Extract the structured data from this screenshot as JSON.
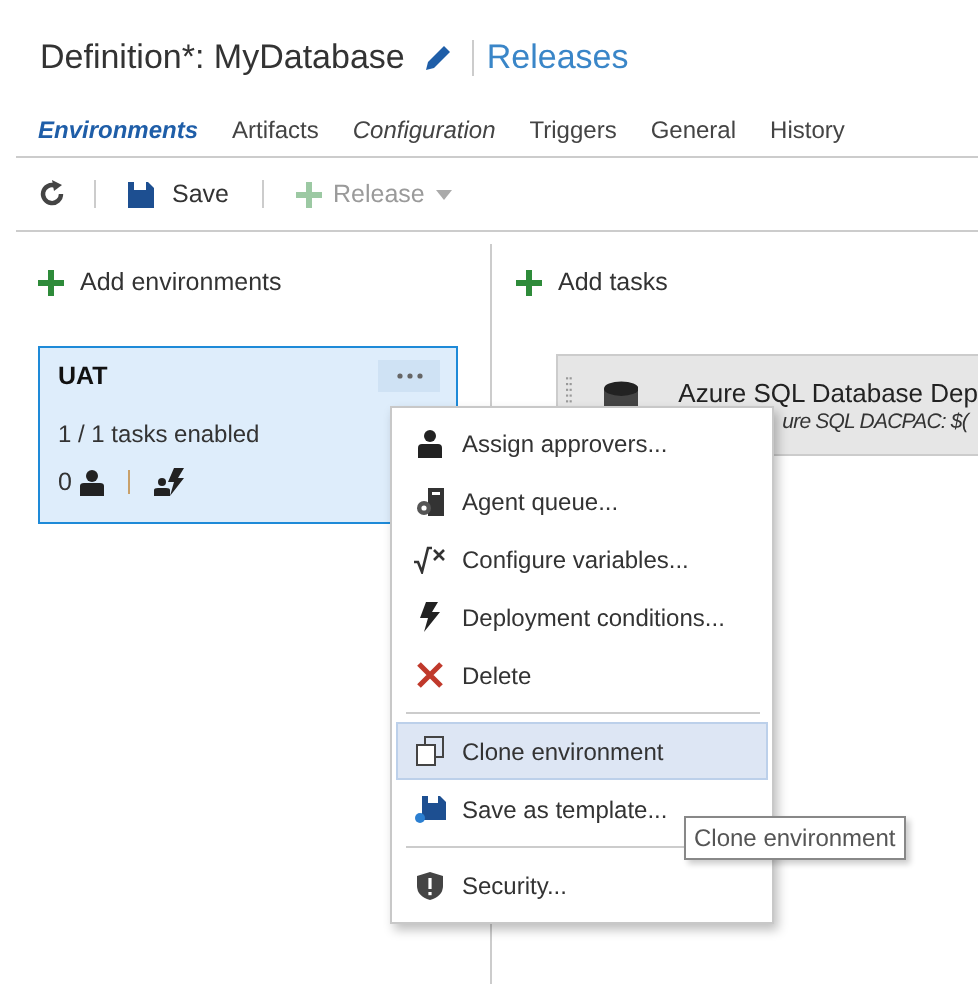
{
  "header": {
    "title": "Definition*: MyDatabase",
    "link": "Releases"
  },
  "tabs": [
    {
      "label": "Environments",
      "selected": true,
      "modified": true
    },
    {
      "label": "Artifacts",
      "selected": false,
      "modified": false
    },
    {
      "label": "Configuration",
      "selected": false,
      "modified": true
    },
    {
      "label": "Triggers",
      "selected": false,
      "modified": false
    },
    {
      "label": "General",
      "selected": false,
      "modified": false
    },
    {
      "label": "History",
      "selected": false,
      "modified": false
    }
  ],
  "toolbar": {
    "save": "Save",
    "release": {
      "label": "Release",
      "disabled": true
    }
  },
  "environments": {
    "add": "Add environments",
    "cards": [
      {
        "name": "UAT",
        "tasks": "1 / 1 tasks enabled",
        "approvers": "0",
        "selected": true
      }
    ]
  },
  "tasks": {
    "add": "Add tasks",
    "items": [
      {
        "title": "Azure SQL Database Dep",
        "subtitle": "ure SQL DACPAC: $("
      }
    ]
  },
  "menu": {
    "groups": [
      {
        "items": [
          {
            "label": "Assign approvers...",
            "kind": "person",
            "selected": false
          },
          {
            "label": "Agent queue...",
            "kind": "agent",
            "selected": false
          },
          {
            "label": "Configure variables...",
            "kind": "fx",
            "selected": false
          },
          {
            "label": "Deployment conditions...",
            "kind": "bolt",
            "selected": false
          },
          {
            "label": "Delete",
            "kind": "delete",
            "selected": false
          }
        ]
      },
      {
        "items": [
          {
            "label": "Clone environment",
            "kind": "clone",
            "selected": true
          },
          {
            "label": "Save as template...",
            "kind": "template",
            "selected": false
          }
        ]
      },
      {
        "items": [
          {
            "label": "Security...",
            "kind": "shield",
            "selected": false
          }
        ]
      }
    ]
  },
  "tooltip": "Clone environment"
}
